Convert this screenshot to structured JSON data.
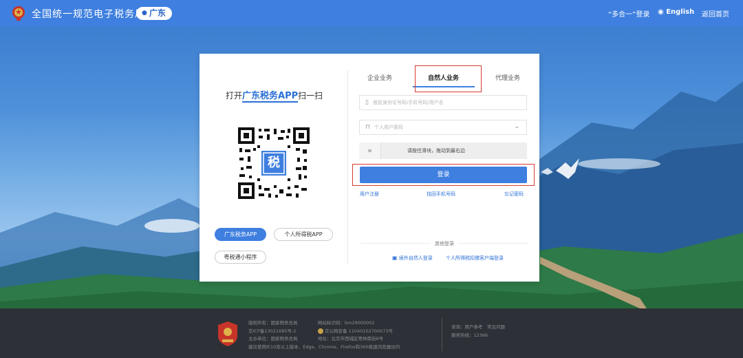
{
  "header": {
    "brand": "全国统一规范电子税务局",
    "region": "广东",
    "nav_login": "“多合一”登录",
    "nav_lang": "English",
    "nav_home": "返回首页"
  },
  "left_panel": {
    "scan_prefix": "打开",
    "scan_app": "广东税务APP",
    "scan_suffix": "扫一扫",
    "qr_center": "税",
    "app_buttons": [
      "广东税务APP",
      "个人所得税APP",
      "粤税通小程序"
    ]
  },
  "tabs": [
    {
      "label": "企业业务",
      "active": false
    },
    {
      "label": "自然人业务",
      "active": true
    },
    {
      "label": "代理业务",
      "active": false
    }
  ],
  "form": {
    "account_placeholder": "居民身份证号码/手机号码/用户名",
    "password_placeholder": "个人用户密码",
    "slider_handle": "»",
    "slider_text": "请按住滑块，拖动到最右边",
    "login_button": "登录",
    "links": [
      "用户注册",
      "找回手机号码",
      "忘记密码"
    ]
  },
  "other_login": {
    "title": "其他登录",
    "links": [
      "境外自然人登录",
      "个人所得税扣缴客户端登录"
    ]
  },
  "footer": {
    "col1": [
      "版权所有：国家税务总局",
      "京ICP备13021685号-2",
      "主办单位：国家税务总局",
      "建议使用IE10及以上版本、Edge、Chrome、Firefox和360极速浏览器访问"
    ],
    "col2": [
      "网站标识码：bm29000002",
      "京公网安备 11040102700073号",
      "地址：北京市西城区枣林南街8号"
    ],
    "col3": [
      "咨询：用户参考　常见问题",
      "服务热线：12366"
    ]
  },
  "colors": {
    "header_bg": "#3e7fe0",
    "accent": "#3e7fe0",
    "highlight_box": "#d9392f",
    "footer_bg": "#2d3036"
  },
  "icons": {
    "emblem": "national-emblem-icon",
    "region_pin": "location-pin-icon",
    "globe": "globe-icon",
    "phone": "phone-icon",
    "lock": "lock-icon",
    "chevron": "chevron-down-icon",
    "double_chevron": "double-chevron-right-icon",
    "overseas": "id-card-icon"
  }
}
